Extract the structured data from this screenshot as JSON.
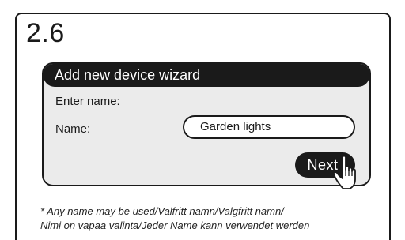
{
  "step": {
    "number": "2.6"
  },
  "wizard": {
    "title": "Add new device wizard",
    "enter_prompt": "Enter name:",
    "name_label": "Name:",
    "name_value": "Garden lights",
    "next_label": "Next"
  },
  "footnote": {
    "line1": "* Any name may be used/Valfritt namn/Valgfritt namn/",
    "line2": "Nimi on vapaa valinta/Jeder Name kann verwendet werden"
  },
  "icons": {
    "cursor": "hand-pointer-icon"
  },
  "colors": {
    "ink": "#1a1a1a",
    "panel": "#ebebeb",
    "background": "#ffffff"
  }
}
